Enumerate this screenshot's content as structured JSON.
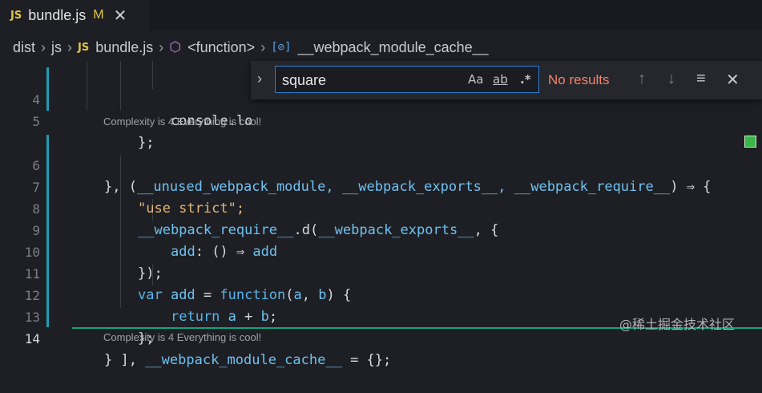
{
  "tab": {
    "badge": "JS",
    "name": "bundle.js",
    "modified": "M",
    "close": "✕"
  },
  "breadcrumb": {
    "items": [
      "dist",
      "js",
      "bundle.js",
      "<function>",
      "__webpack_module_cache__"
    ],
    "badge": "JS",
    "sep": "›"
  },
  "find": {
    "value": "square",
    "match_case": "Aa",
    "whole_word": "ab",
    "regex": ".*",
    "status": "No results",
    "toggle": "›",
    "prev": "↑",
    "next": "↓",
    "selection": "≡",
    "close": "✕"
  },
  "lens": {
    "first": "Complexity is 4 Everything is cool!",
    "second": "Complexity is 4 Everything is cool!"
  },
  "code": {
    "l4": {
      "num": "4",
      "text": "console.lo"
    },
    "l5": {
      "num": "5",
      "text": "};"
    },
    "l6": {
      "num": "6",
      "a": "}, (",
      "b": "__unused_webpack_module, __webpack_exports__, __webpack_require__",
      "c": ") ⇒ {"
    },
    "l7": {
      "num": "7",
      "text": "\"use strict\";"
    },
    "l8": {
      "num": "8",
      "a": "__webpack_require__",
      "b": ".d(",
      "c": "__webpack_exports__",
      "d": ", {"
    },
    "l9": {
      "num": "9",
      "a": "add",
      "b": ": () ⇒ ",
      "c": "add"
    },
    "l10": {
      "num": "10",
      "text": "});"
    },
    "l11": {
      "num": "11",
      "a": "var ",
      "b": "add",
      "c": " = ",
      "d": "function",
      "e": "(",
      "f": "a",
      "g": ", ",
      "h": "b",
      "i": ") {"
    },
    "l12": {
      "num": "12",
      "a": "return ",
      "b": "a",
      "c": " + ",
      "d": "b",
      "e": ";"
    },
    "l13": {
      "num": "13",
      "text": "};"
    },
    "l14": {
      "num": "14",
      "a": "} ], ",
      "b": "__webpack_module_cache__",
      "c": " = {};"
    }
  },
  "watermark": "@稀土掘金技术社区",
  "colors": {
    "accent": "#2a7fd1",
    "no_results": "#f2856a",
    "js_badge": "#e2c542"
  }
}
